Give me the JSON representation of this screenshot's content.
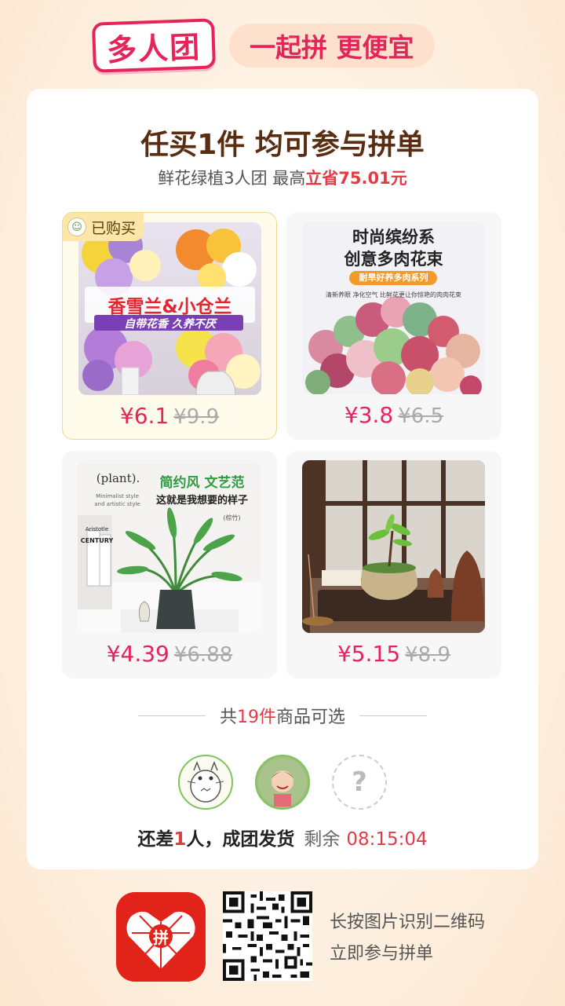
{
  "header": {
    "brand_label": "多人团",
    "slogan": "一起拼 更便宜"
  },
  "card": {
    "title": "任买1件 均可参与拼单",
    "subtitle_prefix": "鲜花绿植3人团 最高",
    "subtitle_saving": "立省75.01元"
  },
  "products": [
    {
      "image_title": "香雪兰&小仓兰",
      "image_subtitle": "自带花香 久养不厌",
      "price": "¥6.1",
      "original_price": "¥9.9",
      "tag": "已购买",
      "selected": true
    },
    {
      "image_title_line1": "时尚缤纷系",
      "image_title_line2": "创意多肉花束",
      "image_pill": "耐旱好养多肉系列",
      "image_caption": "清新养眼 净化空气 比鲜花更让你惊艳的肉肉花束",
      "price": "¥3.8",
      "original_price": "¥6.5"
    },
    {
      "image_brand": "(plant).",
      "image_brand_sub_1": "Minimalist style",
      "image_brand_sub_2": "and artistic style",
      "image_title": "简约风 文艺范",
      "image_subtitle": "这就是我想要的样子",
      "image_note": "(棕竹)",
      "book_1": "Aristotle",
      "book_2": "CENTURY",
      "price": "¥4.39",
      "original_price": "¥6.88"
    },
    {
      "price": "¥5.15",
      "original_price": "¥8.9"
    }
  ],
  "count": {
    "prefix": "共",
    "number": "19件",
    "suffix": "商品可选"
  },
  "avatars": {
    "placeholder_symbol": "?"
  },
  "status": {
    "prefix": "还差",
    "number": "1",
    "suffix": "人，成团发货",
    "remain_label": "剩余",
    "timer": "08:15:04"
  },
  "footer": {
    "logo_text": "拼",
    "line1": "长按图片识别二维码",
    "line2": "立即参与拼单"
  },
  "colors": {
    "accent": "#e6245a",
    "price_red": "#e63946",
    "title_brown": "#5a2d12"
  }
}
